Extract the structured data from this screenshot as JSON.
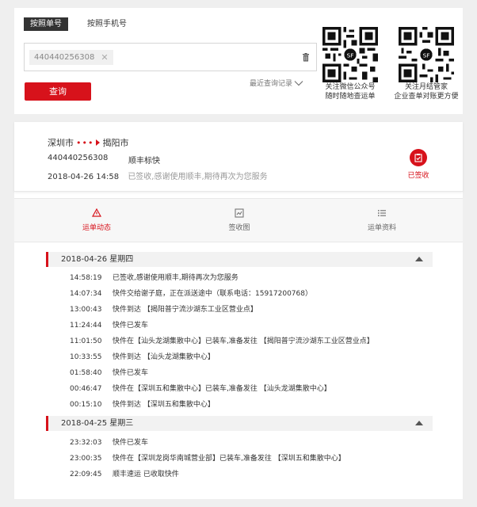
{
  "search": {
    "tab_waybill": "按照单号",
    "tab_phone": "按照手机号",
    "chip_value": "440440256308",
    "chip_close": "✕",
    "recent_label": "最近查询记录",
    "query_button": "查询"
  },
  "qr": [
    {
      "line1": "关注微信公众号",
      "line2": "随时随地查运单"
    },
    {
      "line1": "关注月结管家",
      "line2": "企业查单对账更方便"
    }
  ],
  "waybill": {
    "origin": "深圳市",
    "route_dots": "•••",
    "destination": "揭阳市",
    "number": "440440256308",
    "product": "顺丰标快",
    "datetime": "2018-04-26 14:58",
    "description": "已签收,感谢使用顺丰,期待再次为您服务",
    "status": "已签收"
  },
  "tabs": [
    {
      "label": "运单动态",
      "icon": "truck-icon",
      "active": true
    },
    {
      "label": "签收图",
      "icon": "image-icon",
      "active": false
    },
    {
      "label": "运单资料",
      "icon": "list-icon",
      "active": false
    }
  ],
  "timeline": [
    {
      "date": "2018-04-26 星期四",
      "events": [
        {
          "time": "14:58:19",
          "text": "已签收,感谢使用顺丰,期待再次为您服务"
        },
        {
          "time": "14:07:34",
          "text": "快件交给谢子庭，正在派送途中（联系电话：15917200768）"
        },
        {
          "time": "13:00:43",
          "text": "快件到达 【揭阳普宁流沙湖东工业区营业点】"
        },
        {
          "time": "11:24:44",
          "text": "快件已发车"
        },
        {
          "time": "11:01:50",
          "text": "快件在【汕头龙湖集散中心】已装车,准备发往 【揭阳普宁流沙湖东工业区营业点】"
        },
        {
          "time": "10:33:55",
          "text": "快件到达 【汕头龙湖集散中心】"
        },
        {
          "time": "01:58:40",
          "text": "快件已发车"
        },
        {
          "time": "00:46:47",
          "text": "快件在【深圳五和集散中心】已装车,准备发往 【汕头龙湖集散中心】"
        },
        {
          "time": "00:15:10",
          "text": "快件到达 【深圳五和集散中心】"
        }
      ]
    },
    {
      "date": "2018-04-25 星期三",
      "events": [
        {
          "time": "23:32:03",
          "text": "快件已发车"
        },
        {
          "time": "23:00:35",
          "text": "快件在【深圳龙岗华南城营业部】已装车,准备发往 【深圳五和集散中心】"
        },
        {
          "time": "22:09:45",
          "text": "顺丰速运 已收取快件"
        }
      ]
    }
  ],
  "colors": {
    "accent": "#d7121b",
    "background": "#efefef"
  }
}
